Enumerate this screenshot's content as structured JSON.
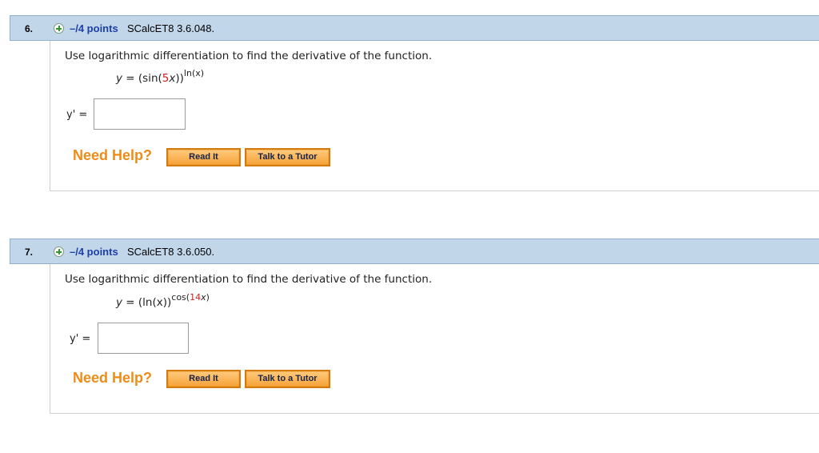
{
  "questions": [
    {
      "number": "6.",
      "points": "–/4 points",
      "code": "SCalcET8 3.6.048.",
      "prompt": "Use logarithmic differentiation to find the derivative of the function.",
      "equation": {
        "lhs": "y",
        "eq": " = (sin(",
        "coef": "5",
        "var": "x",
        "close": "))",
        "exponent": "ln(x)"
      },
      "answer_label": "y' =",
      "answer_value": "",
      "help": {
        "label": "Need Help?",
        "read_it": "Read It",
        "talk_to_tutor": "Talk to a Tutor"
      }
    },
    {
      "number": "7.",
      "points": "–/4 points",
      "code": "SCalcET8 3.6.050.",
      "prompt": "Use logarithmic differentiation to find the derivative of the function.",
      "equation": {
        "lhs": "y",
        "eq": " = (ln(x))",
        "exp_prefix": "cos(",
        "exp_coef": "14",
        "exp_var": "x",
        "exp_close": ")"
      },
      "answer_label": "y' =",
      "answer_value": "",
      "help": {
        "label": "Need Help?",
        "read_it": "Read It",
        "talk_to_tutor": "Talk to a Tutor"
      }
    }
  ],
  "colors": {
    "header_bg": "#c2d6ea",
    "points": "#1d3fa8",
    "need_help": "#ef8b17",
    "button": "#f19a2a",
    "coef_red": "#cc1a1a"
  }
}
